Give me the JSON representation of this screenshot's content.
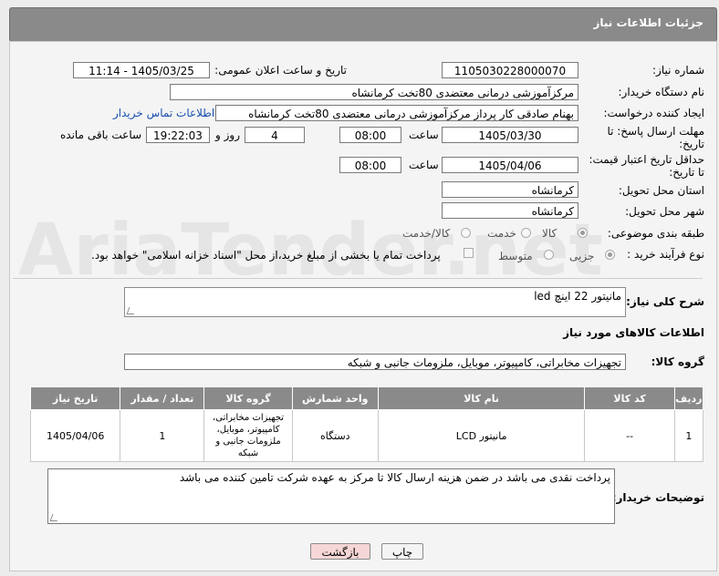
{
  "header": {
    "title": "جزئیات اطلاعات نیاز"
  },
  "fields": {
    "need_number_label": "شماره نیاز:",
    "need_number": "1105030228000070",
    "announce_label": "تاریخ و ساعت اعلان عمومی:",
    "announce_value": "1405/03/25 - 11:14",
    "buyer_org_label": "نام دستگاه خریدار:",
    "buyer_org": "مرکزآموزشی درمانی معتضدی 80تخت کرمانشاه",
    "creator_label": "ایجاد کننده درخواست:",
    "creator": "بهنام صادقی کار پرداز مرکزآموزشی درمانی معتضدی 80تخت کرمانشاه",
    "contact_link": "اطلاعات تماس خریدار",
    "deadline_label_1": "مهلت ارسال پاسخ: تا",
    "deadline_label_2": "تاریخ:",
    "deadline_date": "1405/03/30",
    "time_label": "ساعت",
    "deadline_time": "08:00",
    "days_value": "4",
    "days_label": "روز و",
    "remaining_time": "19:22:03",
    "remaining_label": "ساعت باقی مانده",
    "validity_label_1": "حداقل تاریخ اعتبار قیمت:",
    "validity_label_2": "تا تاریخ:",
    "validity_date": "1405/04/06",
    "validity_time": "08:00",
    "province_label": "استان محل تحویل:",
    "province": "کرمانشاه",
    "city_label": "شهر محل تحویل:",
    "city": "کرمانشاه",
    "category_label": "طبقه بندی موضوعی:",
    "category_options": [
      "کالا",
      "خدمت",
      "کالا/خدمت"
    ],
    "process_label": "نوع فرآیند خرید :",
    "process_options": [
      "جزیی",
      "متوسط"
    ],
    "payment_note": "پرداخت تمام یا بخشی از مبلغ خرید،از محل \"اسناد خزانه اسلامی\" خواهد بود."
  },
  "summary": {
    "label": "شرح کلی نیاز:",
    "value": "مانیتور 22 اینچ led"
  },
  "goods_section": {
    "title": "اطلاعات کالاهای مورد نیاز",
    "group_label": "گروه کالا:",
    "group_value": "تجهیزات مخابراتی، کامپیوتر، موبایل، ملزومات جانبی و شبکه"
  },
  "table": {
    "headers": [
      "ردیف",
      "کد کالا",
      "نام کالا",
      "واحد شمارش",
      "گروه کالا",
      "تعداد / مقدار",
      "تاریخ نیاز"
    ],
    "rows": [
      [
        "1",
        "--",
        "مانیتور LCD",
        "دستگاه",
        "تجهیزات مخابراتی، کامپیوتر، موبایل، ملزومات جانبی و شبکه",
        "1",
        "1405/04/06"
      ]
    ]
  },
  "buyer_notes": {
    "label": "توضیحات خریدار:",
    "value": "پرداخت نقدی می باشد در ضمن هزینه ارسال کالا تا مرکز به عهده شرکت تامین کننده می باشد"
  },
  "buttons": {
    "print": "چاپ",
    "back": "بازگشت"
  },
  "watermark": "AriaTender.net",
  "colors": {
    "header_bg": "#8a8a8a",
    "link": "#1a4fb0",
    "back_btn_bg": "#f6d6d6",
    "print_btn_bg": "#f4f4f4"
  }
}
